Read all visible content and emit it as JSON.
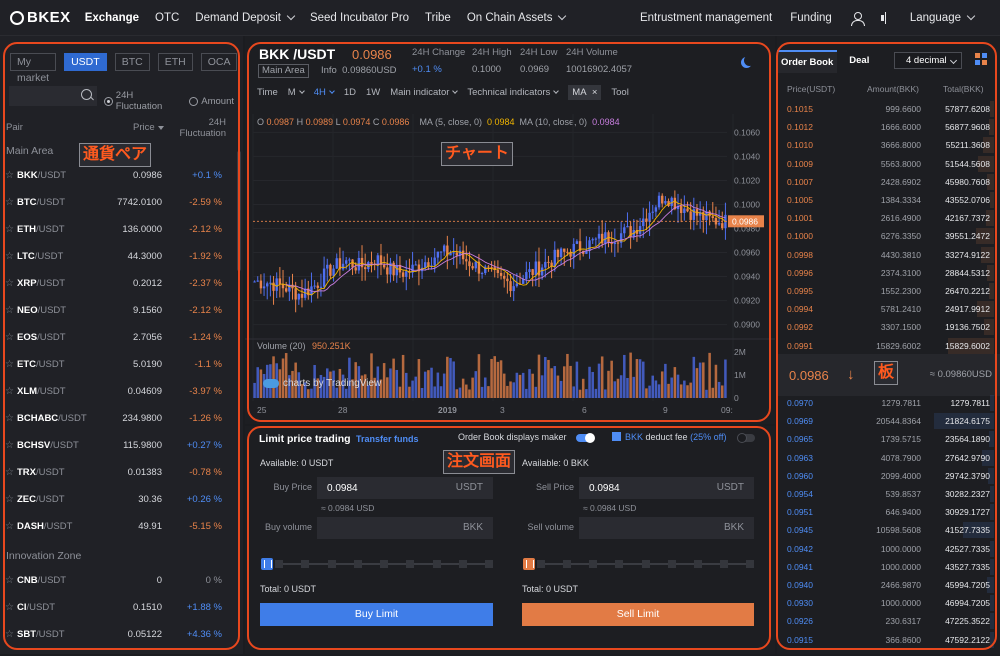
{
  "brand": "BKEX",
  "nav": {
    "items": [
      "Exchange",
      "OTC",
      "Demand Deposit",
      "Seed Incubator Pro",
      "Tribe",
      "On Chain Assets"
    ],
    "right": [
      "Entrustment management",
      "Funding",
      "Language"
    ]
  },
  "annotations": {
    "pairs": "通貨ペア",
    "chart": "チャート",
    "order": "注文画面",
    "book": "板"
  },
  "market": {
    "tabs": [
      "My market",
      "USDT",
      "BTC",
      "ETH",
      "OCA"
    ],
    "active_tab": "USDT",
    "filter_fluctuation": "24H Fluctuation",
    "filter_amount": "Amount",
    "col_pair": "Pair",
    "col_price": "Price",
    "col_change": "24H Fluctuation",
    "main_area": "Main Area",
    "innovation_zone": "Innovation Zone",
    "quote": "/USDT",
    "main_pairs": [
      {
        "sym": "BKK",
        "price": "0.0986",
        "chg": "+0.1 %",
        "dir": "up"
      },
      {
        "sym": "BTC",
        "price": "7742.0100",
        "chg": "-2.59 %",
        "dir": "down"
      },
      {
        "sym": "ETH",
        "price": "136.0000",
        "chg": "-2.12 %",
        "dir": "down"
      },
      {
        "sym": "LTC",
        "price": "44.3000",
        "chg": "-1.92 %",
        "dir": "down"
      },
      {
        "sym": "XRP",
        "price": "0.2012",
        "chg": "-2.37 %",
        "dir": "down"
      },
      {
        "sym": "NEO",
        "price": "9.1560",
        "chg": "-2.12 %",
        "dir": "down"
      },
      {
        "sym": "EOS",
        "price": "2.7056",
        "chg": "-1.24 %",
        "dir": "down"
      },
      {
        "sym": "ETC",
        "price": "5.0190",
        "chg": "-1.1 %",
        "dir": "down"
      },
      {
        "sym": "XLM",
        "price": "0.04609",
        "chg": "-3.97 %",
        "dir": "down"
      },
      {
        "sym": "BCHABC",
        "price": "234.9800",
        "chg": "-1.26 %",
        "dir": "down"
      },
      {
        "sym": "BCHSV",
        "price": "115.9800",
        "chg": "+0.27 %",
        "dir": "up"
      },
      {
        "sym": "TRX",
        "price": "0.01383",
        "chg": "-0.78 %",
        "dir": "down"
      },
      {
        "sym": "ZEC",
        "price": "30.36",
        "chg": "+0.26 %",
        "dir": "up"
      },
      {
        "sym": "DASH",
        "price": "49.91",
        "chg": "-5.15 %",
        "dir": "down"
      }
    ],
    "innovation_pairs": [
      {
        "sym": "CNB",
        "price": "0",
        "chg": "0 %",
        "dir": "flat"
      },
      {
        "sym": "CI",
        "price": "0.1510",
        "chg": "+1.88 %",
        "dir": "up"
      },
      {
        "sym": "SBT",
        "price": "0.05122",
        "chg": "+4.36 %",
        "dir": "up"
      }
    ]
  },
  "chart_header": {
    "pair": "BKK /USDT",
    "price": "0.0986",
    "usd": "0.09860USD",
    "main_area": "Main Area",
    "info": "Info",
    "change_label": "24H Change",
    "change": "+0.1 %",
    "high_label": "24H High",
    "high": "0.1000",
    "low_label": "24H Low",
    "low": "0.0969",
    "volume_label": "24H Volume",
    "volume": "10016902.4057"
  },
  "toolbar": {
    "time": "Time",
    "m": "M",
    "h4": "4H",
    "d1": "1D",
    "w1": "1W",
    "main_indicator": "Main indicator",
    "technical": "Technical indicators",
    "ma": "MA",
    "close": "×",
    "tool": "Tool"
  },
  "ohlc": {
    "o_label": "O",
    "o": "0.0987",
    "h_label": "H",
    "h": "0.0989",
    "l_label": "L",
    "l": "0.0974",
    "c_label": "C",
    "c": "0.0986",
    "ma5_label": "MA (5, close, 0)",
    "ma5": "0.0984",
    "ma10_label": "MA (10, close, 0)",
    "ma10": "0.0984"
  },
  "volume_panel": {
    "label": "Volume (20)",
    "value": "950.251K"
  },
  "tradingview": "charts by TradingView",
  "chart_data": {
    "type": "line",
    "price_ticks": [
      "0.1060",
      "0.1040",
      "0.1020",
      "0.1000",
      "0.0980",
      "0.0960",
      "0.0940",
      "0.0920",
      "0.0900"
    ],
    "price_range": [
      0.0893,
      0.1067
    ],
    "last_price": "0.0986",
    "volume_ticks": [
      "2M",
      "1M",
      "0"
    ],
    "x_ticks": [
      "25",
      "28",
      "2019",
      "3",
      "6",
      "9",
      "09:"
    ],
    "candle_keypoints": [
      0.0936,
      0.0935,
      0.0931,
      0.0925,
      0.0933,
      0.0946,
      0.0953,
      0.0948,
      0.0955,
      0.0945,
      0.0943,
      0.0951,
      0.0958,
      0.0961,
      0.0953,
      0.0946,
      0.0938,
      0.0934,
      0.0942,
      0.095,
      0.0957,
      0.0963,
      0.0967,
      0.0972,
      0.0975,
      0.0979,
      0.0995,
      0.1008,
      0.0999,
      0.0992,
      0.0987,
      0.0986
    ],
    "up_color": "#4f6ff0",
    "down_color": "#e8834a"
  },
  "order": {
    "title": "Limit price trading",
    "transfer": "Transfer funds",
    "obd": "Order Book displays maker",
    "fee_pre": "BKK",
    "fee_mid": "deduct fee",
    "fee_off": "(25% off)",
    "buy": {
      "available": "Available: 0  USDT",
      "price_label": "Buy Price",
      "price": "0.0984",
      "price_unit": "USDT",
      "hint": "≈ 0.0984 USD",
      "vol_label": "Buy volume",
      "vol_unit": "BKK",
      "total": "Total:   0 USDT",
      "button": "Buy Limit"
    },
    "sell": {
      "available": "Available: 0  BKK",
      "price_label": "Sell Price",
      "price": "0.0984",
      "price_unit": "USDT",
      "hint": "≈ 0.0984 USD",
      "vol_label": "Sell volume",
      "vol_unit": "BKK",
      "total": "Total:   0 USDT",
      "button": "Sell Limit"
    },
    "buy_color": "#3f7de8",
    "sell_color": "#e27b45"
  },
  "orderbook": {
    "tab_book": "Order Book",
    "tab_deal": "Deal",
    "decimals": "4 decimal",
    "col_price": "Price(USDT)",
    "col_amount": "Amount(BKK)",
    "col_total": "Total(BKK)",
    "asks": [
      [
        "0.1015",
        "999.6600",
        "57877.6208"
      ],
      [
        "0.1012",
        "1666.6000",
        "56877.9608"
      ],
      [
        "0.1010",
        "3666.8000",
        "55211.3608"
      ],
      [
        "0.1009",
        "5563.8000",
        "51544.5608"
      ],
      [
        "0.1007",
        "2428.6902",
        "45980.7608"
      ],
      [
        "0.1005",
        "1384.3334",
        "43552.0706"
      ],
      [
        "0.1001",
        "2616.4900",
        "42167.7372"
      ],
      [
        "0.1000",
        "6276.3350",
        "39551.2472"
      ],
      [
        "0.0998",
        "4430.3810",
        "33274.9122"
      ],
      [
        "0.0996",
        "2374.3100",
        "28844.5312"
      ],
      [
        "0.0995",
        "1552.2300",
        "26470.2212"
      ],
      [
        "0.0994",
        "5781.2410",
        "24917.9912"
      ],
      [
        "0.0992",
        "3307.1500",
        "19136.7502"
      ],
      [
        "0.0991",
        "15829.6002",
        "15829.6002"
      ]
    ],
    "mid_price": "0.0986",
    "mid_arrow": "↓",
    "mid_usd": "≈ 0.09860USD",
    "bids": [
      [
        "0.0970",
        "1279.7811",
        "1279.7811"
      ],
      [
        "0.0969",
        "20544.8364",
        "21824.6175"
      ],
      [
        "0.0965",
        "1739.5715",
        "23564.1890"
      ],
      [
        "0.0963",
        "4078.7900",
        "27642.9790"
      ],
      [
        "0.0960",
        "2099.4000",
        "29742.3790"
      ],
      [
        "0.0954",
        "539.8537",
        "30282.2327"
      ],
      [
        "0.0951",
        "646.9400",
        "30929.1727"
      ],
      [
        "0.0945",
        "10598.5608",
        "41527.7335"
      ],
      [
        "0.0942",
        "1000.0000",
        "42527.7335"
      ],
      [
        "0.0941",
        "1000.0000",
        "43527.7335"
      ],
      [
        "0.0940",
        "2466.9870",
        "45994.7205"
      ],
      [
        "0.0930",
        "1000.0000",
        "46994.7205"
      ],
      [
        "0.0926",
        "230.6317",
        "47225.3522"
      ],
      [
        "0.0915",
        "366.8600",
        "47592.2122"
      ]
    ],
    "ask_color": "#e8834a",
    "bid_color": "#4f8df5"
  }
}
